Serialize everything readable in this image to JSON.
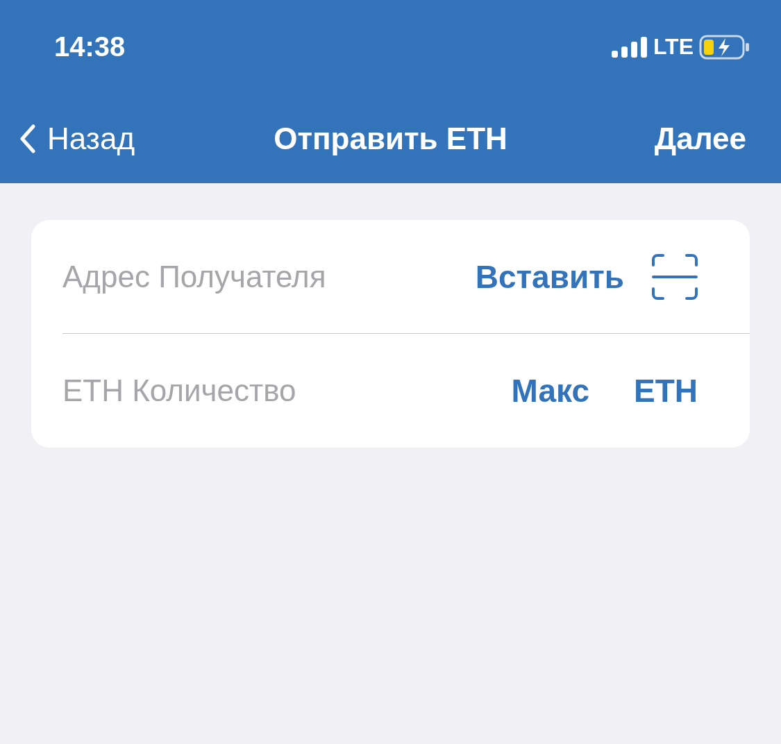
{
  "status_bar": {
    "time": "14:38",
    "network": "LTE"
  },
  "nav_bar": {
    "back": "Назад",
    "title": "Отправить ETH",
    "next": "Далее"
  },
  "form": {
    "rows": [
      {
        "kind": "address",
        "placeholder": "Адрес Получателя",
        "action": "Вставить"
      },
      {
        "kind": "amount",
        "placeholder": "ETH Количество",
        "action": "Макс",
        "unit": "ETH"
      }
    ]
  }
}
